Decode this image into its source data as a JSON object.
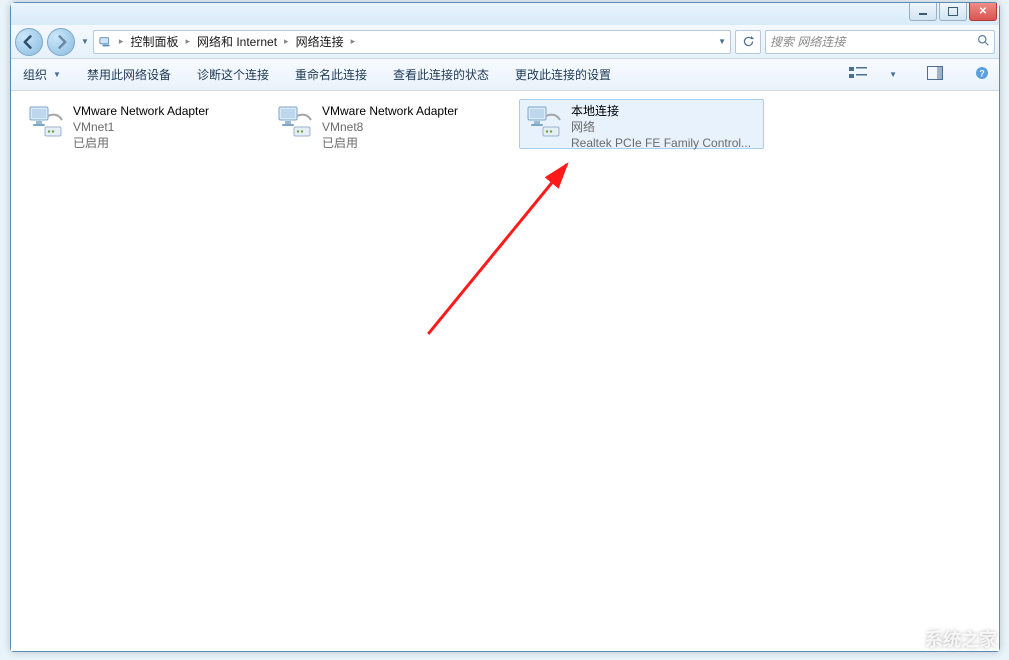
{
  "breadcrumb": {
    "item1": "控制面板",
    "item2": "网络和 Internet",
    "item3": "网络连接"
  },
  "search": {
    "placeholder": "搜索 网络连接"
  },
  "toolbar": {
    "organize": "组织",
    "disable": "禁用此网络设备",
    "diagnose": "诊断这个连接",
    "rename": "重命名此连接",
    "status": "查看此连接的状态",
    "change": "更改此连接的设置"
  },
  "connections": [
    {
      "title": "VMware Network Adapter",
      "line2": "VMnet1",
      "line3": "已启用",
      "selected": false
    },
    {
      "title": "VMware Network Adapter",
      "line2": "VMnet8",
      "line3": "已启用",
      "selected": false
    },
    {
      "title": "本地连接",
      "line2": "网络",
      "line3": "Realtek PCIe FE Family Control...",
      "selected": true
    }
  ],
  "watermark": "系统之家"
}
